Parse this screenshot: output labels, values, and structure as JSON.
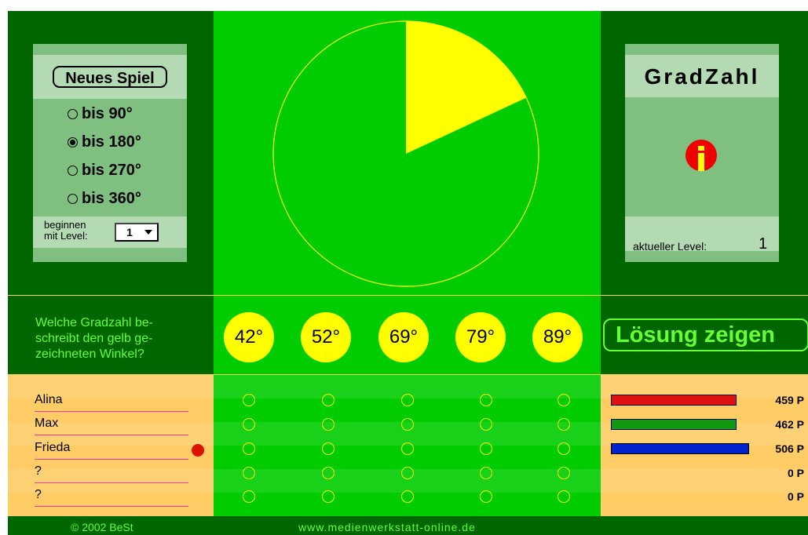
{
  "new_game_label": "Neues Spiel",
  "options": [
    {
      "label": "bis 90°",
      "selected": false
    },
    {
      "label": "bis 180°",
      "selected": true
    },
    {
      "label": "bis 270°",
      "selected": false
    },
    {
      "label": "bis 360°",
      "selected": false
    }
  ],
  "start_level": {
    "label_line1": "beginnen",
    "label_line2": "mit Level:",
    "value": "1"
  },
  "title": "GradZahl",
  "info_icon": "info-icon",
  "current_level": {
    "label": "aktueller Level:",
    "value": "1"
  },
  "angle_degrees": 65,
  "question": [
    "Welche Gradzahl be-",
    "schreibt den gelb ge-",
    "zeichneten Winkel?"
  ],
  "answers": [
    "42°",
    "52°",
    "69°",
    "79°",
    "89°"
  ],
  "show_solution_label": "Lösung zeigen",
  "players": [
    {
      "name": "Alina",
      "points": "459 P",
      "bar_color": "#dd1111",
      "score_fraction": 0.91
    },
    {
      "name": "Max",
      "points": "462 P",
      "bar_color": "#119911",
      "score_fraction": 0.91
    },
    {
      "name": "Frieda",
      "points": "506 P",
      "bar_color": "#0022cc",
      "score_fraction": 1.0,
      "active": true
    },
    {
      "name": "?",
      "points": "0 P"
    },
    {
      "name": "?",
      "points": "0 P"
    }
  ],
  "colors": {
    "accent": "#66ff33",
    "wedge": "#ffff00",
    "board": "#00cc00",
    "dark": "#006600"
  },
  "footer": {
    "copyright": "© 2002 BeSt",
    "website": "www.medienwerkstatt-online.de"
  }
}
